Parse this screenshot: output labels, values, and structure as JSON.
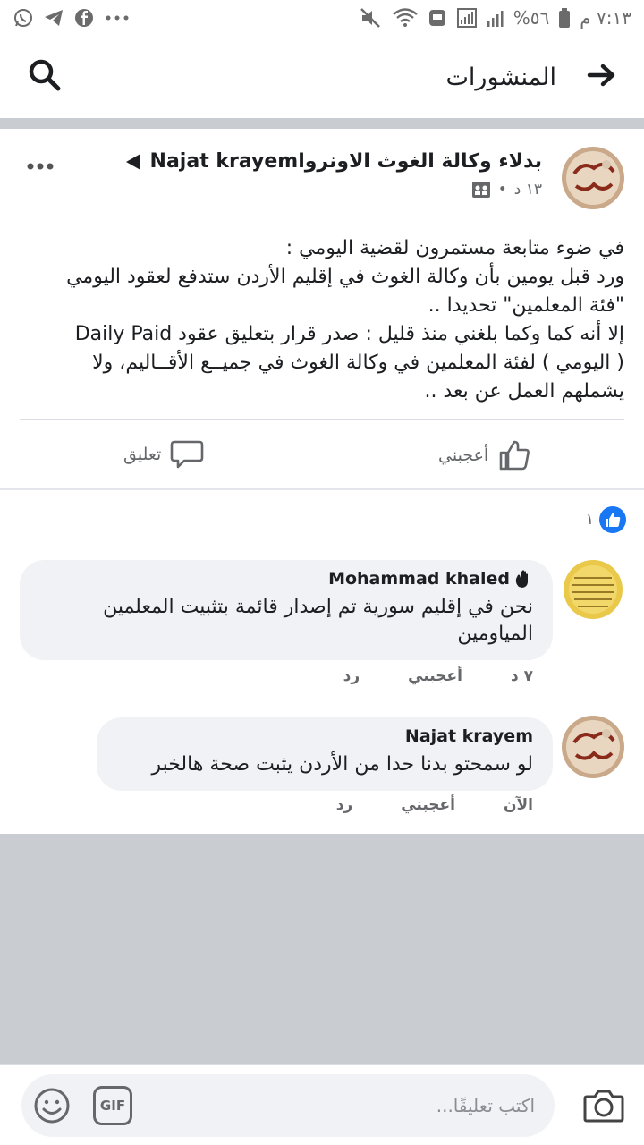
{
  "status_bar": {
    "time": "٧:١٣ م",
    "battery": "%٥٦"
  },
  "header": {
    "title": "المنشورات"
  },
  "post": {
    "author": "بدلاء وكالة الغوث الاونرواNajat krayem",
    "time": "١٣ د",
    "body_lines": [
      "في ضوء متابعة مستمرون لقضية اليومي :",
      "ورد قبل يومين بأن وكالة الغوث في إقليم الأردن ستدفع لعقود اليومي",
      "\"فئة المعلمين\" تحديدا ..",
      "إلا أنه كما وكما بلغني منذ قليل : صدر قرار بتعليق عقود Daily Paid",
      "( اليومي ) لفئة المعلمين في وكالة الغوث في جميــع الأقــاليم، ولا",
      "يشملهم العمل عن بعد .."
    ],
    "like_label": "أعجبني",
    "comment_label": "تعليق",
    "reaction_count": "١"
  },
  "comments": [
    {
      "name": "Mohammad khaled",
      "text": "نحن في إقليم سورية تم إصدار قائمة بتثبيت المعلمين المياومين",
      "time": "٧ د",
      "like": "أعجبني",
      "reply": "رد"
    },
    {
      "name": "Najat krayem",
      "text": "لو سمحتو بدنا حدا من الأردن يثبت صحة هالخبر",
      "time": "الآن",
      "like": "أعجبني",
      "reply": "رد"
    }
  ],
  "composer": {
    "placeholder": "اكتب تعليقًا...",
    "gif_label": "GIF"
  },
  "colors": {
    "accent": "#1877f2",
    "bubble": "#f0f2f5",
    "divider": "#c9ccd1"
  }
}
